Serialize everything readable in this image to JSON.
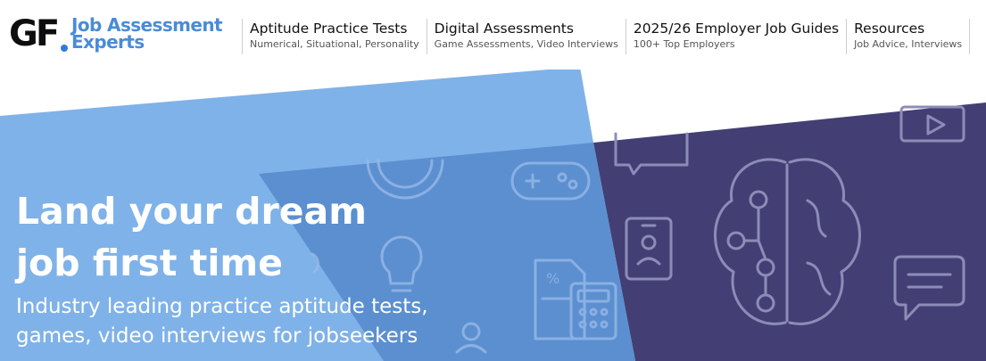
{
  "brand": {
    "logo_mark": "GF",
    "logo_line1": "Job Assessment",
    "logo_line2": "Experts",
    "mark_color": "#0d0d0d",
    "accent_color": "#4a8bd8"
  },
  "nav": {
    "items": [
      {
        "title": "Aptitude Practice Tests",
        "subtitle": "Numerical, Situational, Personality"
      },
      {
        "title": "Digital Assessments",
        "subtitle": "Game Assessments, Video Interviews"
      },
      {
        "title": "2025/26 Employer Job Guides",
        "subtitle": "100+ Top Employers"
      },
      {
        "title": "Resources",
        "subtitle": "Job Advice, Interviews"
      }
    ]
  },
  "hero": {
    "title_line1": "Land your dream",
    "title_line2": "job first time",
    "subtitle_line1": "Industry leading practice aptitude tests,",
    "subtitle_line2": "games, video interviews for jobseekers",
    "colors": {
      "light_blue": "#7fb2e8",
      "mid_blue": "#5b8fd0",
      "navy": "#433f74",
      "icon_stroke": "#b9c9ea"
    }
  },
  "icons": [
    "gamepad-icon",
    "lightbulb-icon",
    "id-card-icon",
    "calculator-document-icon",
    "brain-circuit-icon",
    "chat-bubble-icon",
    "video-play-icon",
    "speech-bubble-icon"
  ]
}
